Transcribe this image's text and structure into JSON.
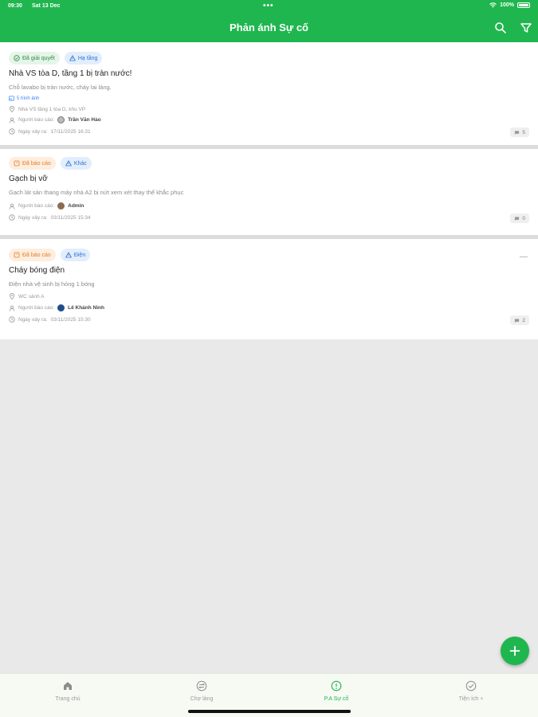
{
  "status_bar": {
    "time": "09:30",
    "date": "Sat 13 Dec",
    "battery": "100%"
  },
  "header": {
    "title": "Phản ánh Sự cố",
    "search_icon": "search-icon",
    "filter_icon": "filter-icon"
  },
  "incidents": [
    {
      "status": "Đã giải quyết",
      "status_color": "#2e8b45",
      "category": "Hạ tầng",
      "title": "Nhà VS tòa D, tầng 1 bị tràn nước!",
      "description": "Chỗ lavabo bị tràn nước, chảy lai láng.",
      "images": "5 hình ảnh",
      "location": "Nhà VS tầng 1 tòa D, khu VP",
      "reporter_label": "Người báo cáo:",
      "reporter": "Trần Văn Hảo",
      "date_label": "Ngày xảy ra:",
      "date": "17/11/2025 16:31",
      "comments": "5"
    },
    {
      "status": "Đã báo cáo",
      "status_color": "#e67e22",
      "category": "Khác",
      "title": "Gạch bị vỡ",
      "description": "Gạch lát sàn thang máy nhà A2 bị nứt xem xét thay thế khắc phục",
      "reporter_label": "Người báo cáo:",
      "reporter": "Admin",
      "date_label": "Ngày xảy ra:",
      "date": "03/11/2025 15:34",
      "comments": "0"
    },
    {
      "status": "Đã báo cáo",
      "status_color": "#e67e22",
      "category": "Điện",
      "title": "Cháy bóng điện",
      "description": "Điện nhà vệ sinh bị hỏng 1 bóng",
      "location": "WC sảnh A",
      "reporter_label": "Người báo cáo:",
      "reporter": "Lê Khánh Ninh",
      "date_label": "Ngày xảy ra:",
      "date": "03/11/2025 15:30",
      "comments": "2"
    }
  ],
  "fab": {
    "icon": "plus-icon"
  },
  "tabs": [
    {
      "label": "Trang chủ",
      "icon": "home-icon"
    },
    {
      "label": "Chợ làng",
      "icon": "exchange-icon"
    },
    {
      "label": "P.A Sự cố",
      "icon": "alert-icon",
      "active": true
    },
    {
      "label": "Tiện ích +",
      "icon": "check-circle-icon"
    }
  ],
  "colors": {
    "primary": "#20b64f",
    "background": "#e9e9e9"
  }
}
